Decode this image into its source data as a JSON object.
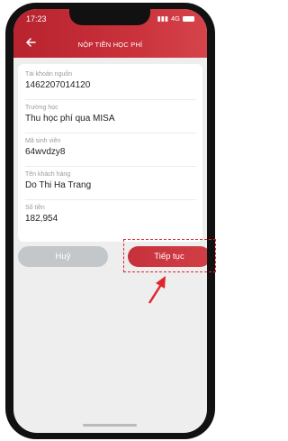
{
  "status": {
    "time": "17:23",
    "network": "4G"
  },
  "header": {
    "title": "NỘP TIỀN HỌC PHÍ"
  },
  "fields": [
    {
      "label": "Tài khoản nguồn",
      "value": "1462207014120"
    },
    {
      "label": "Trường học",
      "value": "Thu học phí qua MISA"
    },
    {
      "label": "Mã sinh viên",
      "value": "64wvdzy8"
    },
    {
      "label": "Tên khách hàng",
      "value": "Do Thi Ha Trang"
    },
    {
      "label": "Số tiền",
      "value": "182,954"
    }
  ],
  "buttons": {
    "cancel": "Huỷ",
    "next": "Tiếp tục"
  },
  "colors": {
    "brand": "#c6313b",
    "annotation": "#e0262d",
    "cancel": "#c4c7ca"
  }
}
